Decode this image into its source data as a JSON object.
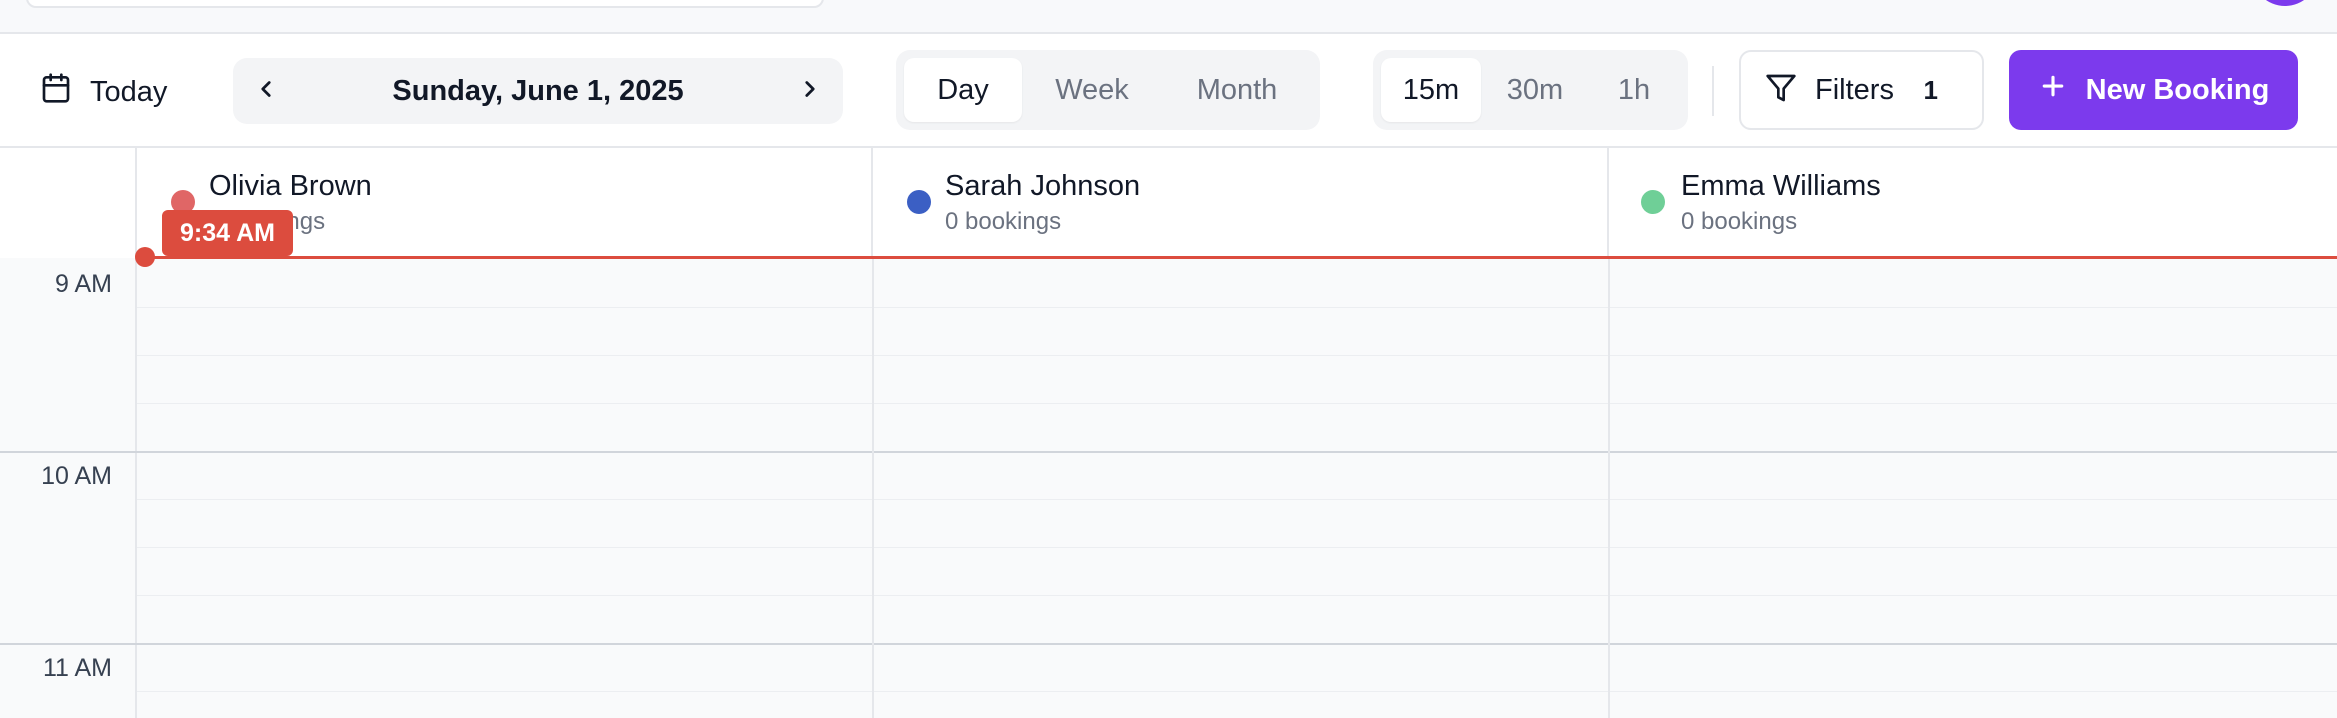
{
  "toolbar": {
    "today_label": "Today",
    "date_label": "Sunday, June 1, 2025",
    "views": [
      {
        "label": "Day",
        "active": true
      },
      {
        "label": "Week",
        "active": false
      },
      {
        "label": "Month",
        "active": false
      }
    ],
    "intervals": [
      {
        "label": "15m",
        "active": true
      },
      {
        "label": "30m",
        "active": false
      },
      {
        "label": "1h",
        "active": false
      }
    ],
    "filters_label": "Filters",
    "filters_count": "1",
    "new_booking_label": "New Booking"
  },
  "icons": {
    "today": "calendar-icon",
    "prev": "chevron-left-icon",
    "next": "chevron-right-icon",
    "filters": "filter-icon",
    "new_booking": "plus-icon"
  },
  "staff": [
    {
      "name": "Olivia Brown",
      "bookings": "0 bookings",
      "color": "#e06666"
    },
    {
      "name": "Sarah Johnson",
      "bookings": "0 bookings",
      "color": "#3b5fc4"
    },
    {
      "name": "Emma Williams",
      "bookings": "0 bookings",
      "color": "#6fcf97"
    }
  ],
  "time_labels": [
    "9 AM",
    "10 AM",
    "11 AM"
  ],
  "now_indicator": {
    "time": "9:34 AM"
  },
  "colors": {
    "accent": "#7c3aed",
    "now": "#dc4c3e"
  }
}
